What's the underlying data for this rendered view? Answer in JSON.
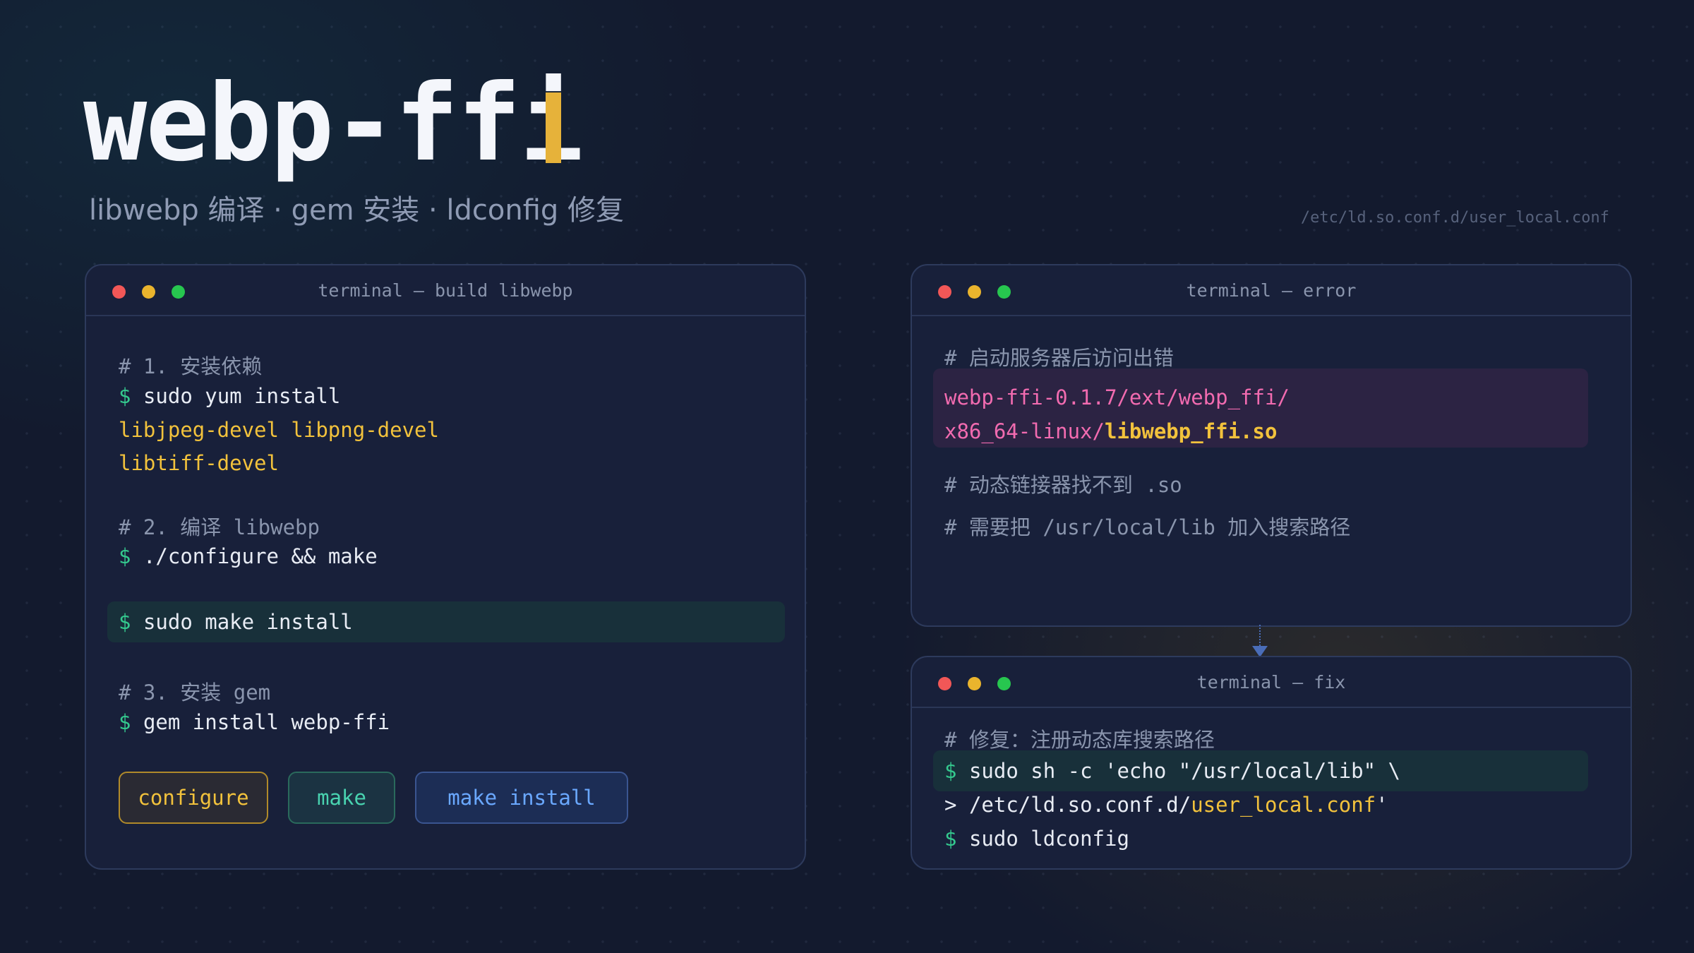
{
  "header": {
    "title": "webp-ffi",
    "subtitle": "libwebp 编译 · gem 安装 · ldconfig 修复",
    "config_path": "/etc/ld.so.conf.d/user_local.conf"
  },
  "build_window": {
    "title": "terminal — build libwebp",
    "step1_comment": "# 1. 安装依赖",
    "prompt": "$",
    "yum_cmd": "sudo yum install",
    "deps_line1": "libjpeg-devel libpng-devel",
    "deps_line2": "libtiff-devel",
    "step2_comment": "# 2. 编译 libwebp",
    "configure_cmd": "./configure && make",
    "install_cmd": "sudo make install",
    "step3_comment": "# 3. 安装 gem",
    "gem_cmd": "gem install webp-ffi",
    "buttons": {
      "configure": "configure",
      "make": "make",
      "make_install": "make install"
    }
  },
  "error_window": {
    "title": "terminal — error",
    "comment1": "# 启动服务器后访问出错",
    "path_line1": "webp-ffi-0.1.7/ext/webp_ffi/",
    "path_line2_prefix": "x86_64-linux/",
    "path_line2_file": "libwebp_ffi.so",
    "comment2": "# 动态链接器找不到 .so",
    "comment3": "# 需要把 /usr/local/lib 加入搜索路径"
  },
  "fix_window": {
    "title": "terminal — fix",
    "comment": "# 修复：注册动态库搜索路径",
    "prompt": "$",
    "cmd1": "sudo sh -c 'echo \"/usr/local/lib\" \\",
    "cont_marker": ">",
    "cmd2_prefix": "/etc/ld.so.conf.d/",
    "cmd2_file": "user_local.conf",
    "cmd2_suffix": "'",
    "cmd3": "sudo ldconfig"
  },
  "colors": {
    "background": "#131a2e",
    "window": "#18203a",
    "prompt": "#34c98e",
    "highlight_yellow": "#f2c23c",
    "error_pink": "#f26bb0",
    "cursor": "#e6b23a"
  }
}
